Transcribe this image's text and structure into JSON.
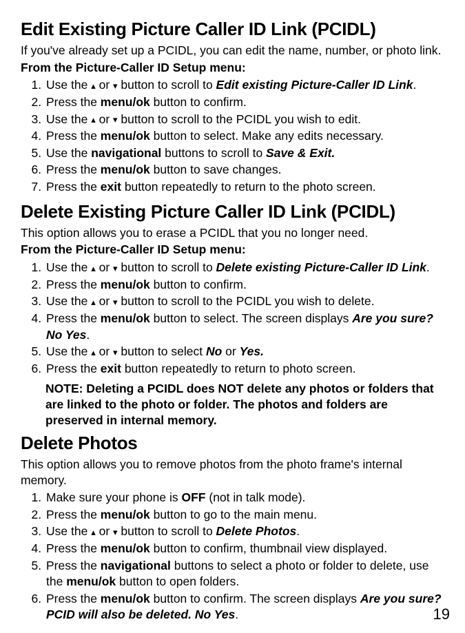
{
  "sections": {
    "edit": {
      "title": "Edit Existing Picture Caller ID Link (PCIDL)",
      "intro": "If you've already set up a PCIDL, you can edit the name, number, or photo link.",
      "submenu": "From the Picture-Caller ID Setup menu:",
      "steps": {
        "s1a": "Use the ",
        "s1b": " or ",
        "s1c": " button to scroll to ",
        "s1d": "Edit existing Picture-Caller ID Link",
        "s1e": ".",
        "s2a": "Press the ",
        "s2b": "menu/ok",
        "s2c": " button to confirm.",
        "s3a": "Use the ",
        "s3b": " or ",
        "s3c": " button to scroll to the PCIDL you wish to edit.",
        "s4a": "Press the ",
        "s4b": "menu/ok",
        "s4c": " button to select. Make any edits necessary.",
        "s5a": "Use the ",
        "s5b": "navigational",
        "s5c": " buttons to scroll to ",
        "s5d": "Save & Exit.",
        "s6a": "Press the ",
        "s6b": "menu/ok",
        "s6c": " button to save changes.",
        "s7a": "Press the ",
        "s7b": "exit",
        "s7c": " button repeatedly to return to the photo screen."
      }
    },
    "delete": {
      "title": "Delete Existing Picture Caller ID Link (PCIDL)",
      "intro": "This option allows you to erase a PCIDL that you no longer need.",
      "submenu": "From the Picture-Caller ID Setup menu:",
      "steps": {
        "s1a": "Use the ",
        "s1b": " or ",
        "s1c": " button to scroll to ",
        "s1d": "Delete existing Picture-Caller ID Link",
        "s1e": ".",
        "s2a": "Press the ",
        "s2b": "menu/ok",
        "s2c": " button to confirm.",
        "s3a": "Use the ",
        "s3b": " or ",
        "s3c": " button to scroll to the PCIDL you wish to delete.",
        "s4a": "Press the ",
        "s4b": "menu/ok",
        "s4c": " button to select. The screen displays ",
        "s4d": "Are you sure?  No  Yes",
        "s4e": ".",
        "s5a": "Use the ",
        "s5b": " or ",
        "s5c": " button to select ",
        "s5d": "No",
        "s5e": " or ",
        "s5f": "Yes.",
        "s6a": "Press the ",
        "s6b": "exit",
        "s6c": " button repeatedly to return to photo screen."
      },
      "note": "NOTE: Deleting a PCIDL does NOT delete any photos or folders that are linked to the photo or folder. The photos and folders are preserved in internal memory."
    },
    "photos": {
      "title": "Delete Photos",
      "intro": "This option allows you to remove photos from the photo frame's internal memory.",
      "steps": {
        "s1a": "Make sure your phone is ",
        "s1b": "OFF",
        "s1c": " (not in talk mode).",
        "s2a": "Press the ",
        "s2b": "menu/ok",
        "s2c": " button to go to the main menu.",
        "s3a": "Use the ",
        "s3b": " or ",
        "s3c": " button to scroll to ",
        "s3d": "Delete Photos",
        "s3e": ".",
        "s4a": "Press the ",
        "s4b": "menu/ok",
        "s4c": " button to confirm, thumbnail view displayed.",
        "s5a": "Press the ",
        "s5b": "navigational",
        "s5c": " buttons to select a photo or folder to delete, use the ",
        "s5d": "menu/ok",
        "s5e": " button to open folders.",
        "s6a": "Press the ",
        "s6b": "menu/ok",
        "s6c": " button to confirm. The screen displays  ",
        "s6d": "Are you sure?  PCID will also be deleted.  No  Yes",
        "s6e": "."
      }
    }
  },
  "arrows": {
    "up": "▴",
    "down": "▾"
  },
  "page": "19"
}
